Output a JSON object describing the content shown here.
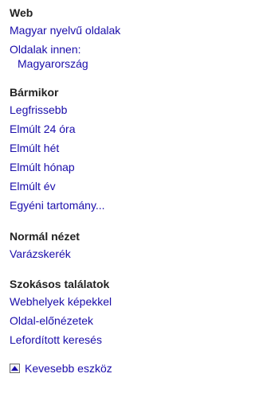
{
  "sections": {
    "web": {
      "heading": "Web",
      "items": [
        "Magyar nyelvű oldalak",
        "Oldalak innen:",
        "Magyarország"
      ]
    },
    "time": {
      "heading": "Bármikor",
      "items": [
        "Legfrissebb",
        "Elmúlt 24 óra",
        "Elmúlt hét",
        "Elmúlt hónap",
        "Elmúlt év",
        "Egyéni tartomány..."
      ]
    },
    "view": {
      "heading": "Normál nézet",
      "items": [
        "Varázskerék"
      ]
    },
    "results": {
      "heading": "Szokásos találatok",
      "items": [
        "Webhelyek képekkel",
        "Oldal-előnézetek",
        "Lefordított keresés"
      ]
    }
  },
  "tools_toggle": {
    "label": "Kevesebb eszköz",
    "icon": "triangle-up-icon"
  },
  "colors": {
    "link": "#1a0dab",
    "heading": "#222222",
    "background": "#ffffff"
  }
}
